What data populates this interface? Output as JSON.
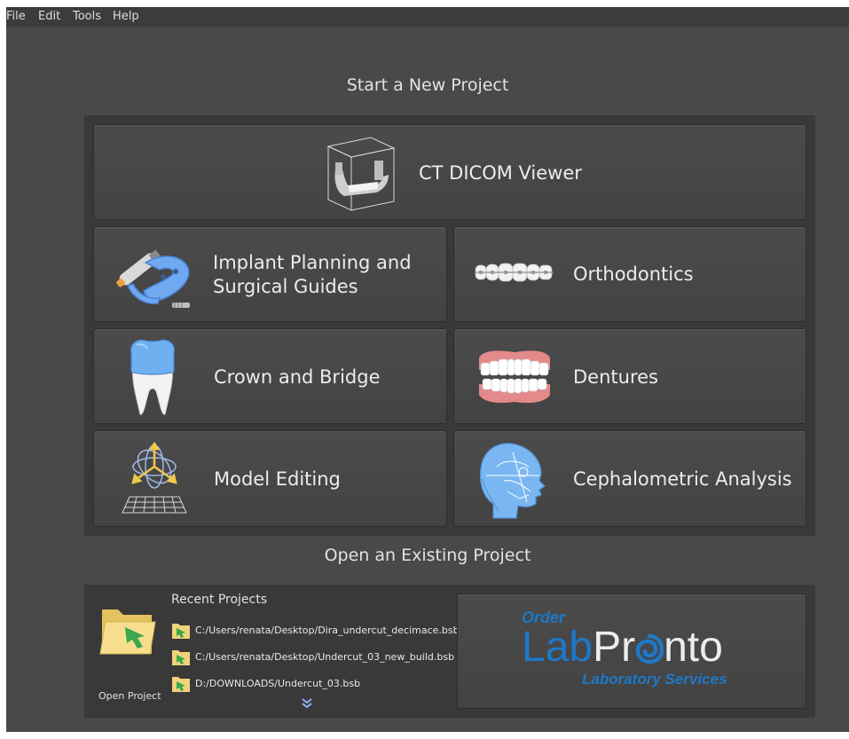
{
  "menu": [
    "File",
    "Edit",
    "Tools",
    "Help"
  ],
  "new_project_title": "Start a New Project",
  "tiles": {
    "ct_dicom": "CT DICOM Viewer",
    "implant_line1": "Implant Planning and",
    "implant_line2": "Surgical Guides",
    "orthodontics": "Orthodontics",
    "crown": "Crown and Bridge",
    "dentures": "Dentures",
    "model_editing": "Model Editing",
    "cephalometric": "Cephalometric Analysis"
  },
  "existing_project_title": "Open an Existing Project",
  "open_project_label": "Open Project",
  "recent": {
    "title": "Recent Projects",
    "items": [
      "C:/Users/renata/Desktop/Dira_undercut_decimace.bsb",
      "C:/Users/renata/Desktop/Undercut_03_new_build.bsb",
      "D:/DOWNLOADS/Undercut_03.bsb"
    ]
  },
  "labpronto": {
    "order": "Order",
    "lab": "Lab",
    "pr": "Pr",
    "nto": "nto",
    "tagline": "Laboratory Services"
  },
  "colors": {
    "background": "#494949",
    "panel": "#393939",
    "tile": "#474747",
    "brand_blue": "#1e78c8",
    "text": "#ececec"
  },
  "icons": [
    "dicom-cube-icon",
    "implant-guide-icon",
    "braces-icon",
    "tooth-crown-icon",
    "dentures-icon",
    "model-edit-icon",
    "cephalometric-head-icon",
    "folder-open-icon",
    "file-arrow-icon",
    "chevron-double-down-icon"
  ]
}
